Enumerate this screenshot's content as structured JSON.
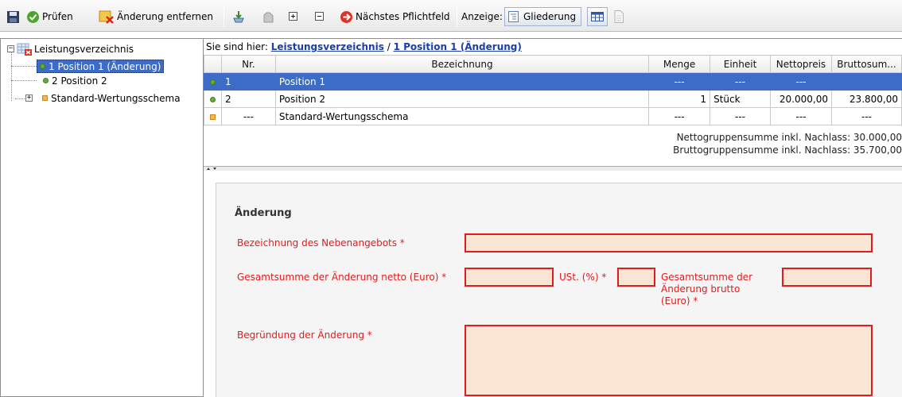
{
  "toolbar": {
    "check_label": "Prüfen",
    "remove_label": "Änderung entfernen",
    "next_required_label": "Nächstes Pflichtfeld",
    "display_label": "Anzeige:",
    "outline_label": "Gliederung"
  },
  "tree": {
    "root": "Leistungsverzeichnis",
    "items": [
      {
        "label": "1 Position 1 (Änderung)"
      },
      {
        "label": "2 Position 2"
      },
      {
        "label": "Standard-Wertungsschema"
      }
    ]
  },
  "breadcrumb": {
    "prefix": "Sie sind hier:",
    "link1": "Leistungsverzeichnis",
    "separator": "/",
    "link2": "1 Position 1 (Änderung)"
  },
  "table": {
    "headers": [
      "Nr.",
      "Bezeichnung",
      "Menge",
      "Einheit",
      "Nettopreis",
      "Bruttosum..."
    ],
    "rows": [
      {
        "nr": "1",
        "bez": "Position 1",
        "menge": "---",
        "einheit": "---",
        "netto": "---",
        "brutto": ""
      },
      {
        "nr": "2",
        "bez": "Position 2",
        "menge": "1",
        "einheit": "Stück",
        "netto": "20.000,00",
        "brutto": "23.800,00"
      },
      {
        "nr": "---",
        "bez": "Standard-Wertungsschema",
        "menge": "---",
        "einheit": "---",
        "netto": "---",
        "brutto": "---"
      }
    ]
  },
  "sums": {
    "netto": "Nettogruppensumme inkl. Nachlass: 30.000,00",
    "brutto": "Bruttogruppensumme inkl. Nachlass: 35.700,00"
  },
  "form": {
    "title": "Änderung",
    "label_bezeichnung": "Bezeichnung des Nebenangebots *",
    "label_netto": "Gesamtsumme der Änderung netto (Euro) *",
    "label_ust": "USt. (%) *",
    "label_brutto_l1": "Gesamtsumme der",
    "label_brutto_l2": "Änderung brutto",
    "label_brutto_l3": "(Euro) *",
    "label_begruendung": "Begründung der Änderung *"
  },
  "colors": {
    "selection": "#3a6cc8",
    "required": "#e31b1b",
    "field_fill": "#fbe6d6"
  }
}
